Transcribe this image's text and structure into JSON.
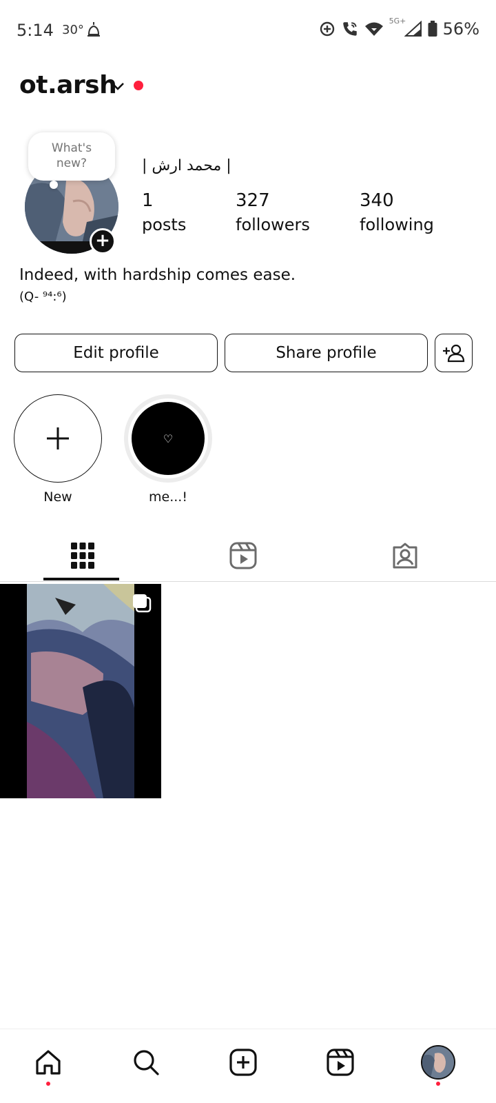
{
  "status_bar": {
    "time": "5:14",
    "temperature": "30°",
    "network": "5G+",
    "battery": "56%"
  },
  "profile": {
    "username": "ot.arsh",
    "display_name": "| محمد ارش |",
    "note_bubble": "What's new?",
    "stats": {
      "posts_count": "1",
      "posts_label": "posts",
      "followers_count": "327",
      "followers_label": "followers",
      "following_count": "340",
      "following_label": "following"
    },
    "bio": "Indeed, with hardship comes ease.",
    "bio_ref": "(Q- ⁹⁴:⁶)"
  },
  "actions": {
    "edit_label": "Edit profile",
    "share_label": "Share profile"
  },
  "highlights": [
    {
      "label": "New"
    },
    {
      "label": "me...!",
      "cover_glyph": "♡"
    }
  ],
  "tabs": [
    "grid-icon",
    "reels-icon",
    "tagged-icon"
  ],
  "bottom_nav": [
    "home-icon",
    "search-icon",
    "create-icon",
    "reels-icon",
    "profile-avatar"
  ],
  "colors": {
    "accent_red": "#ff1f3d",
    "text": "#111111",
    "muted": "#737373"
  }
}
